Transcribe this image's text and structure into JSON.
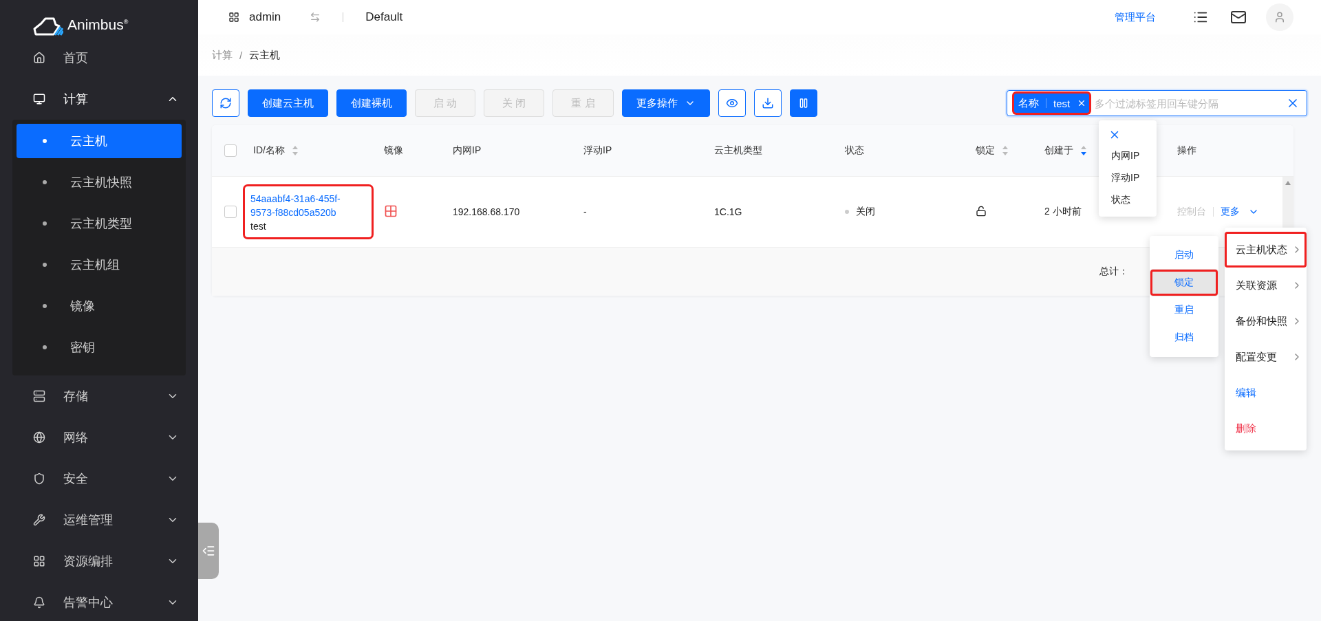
{
  "brand": {
    "name": "Animbus",
    "mark": "®"
  },
  "sidebar": {
    "items": [
      {
        "label": "首页",
        "kind": "link",
        "expanded": false
      },
      {
        "label": "计算",
        "kind": "group",
        "expanded": true,
        "children": [
          {
            "label": "云主机",
            "selected": true
          },
          {
            "label": "云主机快照",
            "selected": false
          },
          {
            "label": "云主机类型",
            "selected": false
          },
          {
            "label": "云主机组",
            "selected": false
          },
          {
            "label": "镜像",
            "selected": false
          },
          {
            "label": "密钥",
            "selected": false
          }
        ]
      },
      {
        "label": "存储",
        "kind": "group",
        "expanded": false
      },
      {
        "label": "网络",
        "kind": "group",
        "expanded": false
      },
      {
        "label": "安全",
        "kind": "group",
        "expanded": false
      },
      {
        "label": "运维管理",
        "kind": "group",
        "expanded": false
      },
      {
        "label": "资源编排",
        "kind": "group",
        "expanded": false
      },
      {
        "label": "告警中心",
        "kind": "group",
        "expanded": false
      }
    ]
  },
  "header": {
    "project": "admin",
    "region": "Default",
    "admin_link": "管理平台"
  },
  "breadcrumb": {
    "items": [
      "计算",
      "云主机"
    ],
    "separator": "/"
  },
  "toolbar": {
    "buttons": [
      {
        "label": "创建云主机",
        "disabled": false
      },
      {
        "label": "创建裸机",
        "disabled": false
      },
      {
        "label": "启 动",
        "disabled": true
      },
      {
        "label": "关 闭",
        "disabled": true
      },
      {
        "label": "重 启",
        "disabled": true
      }
    ],
    "more_button": "更多操作"
  },
  "search": {
    "tag": {
      "key": "名称",
      "value": "test",
      "annotated": true
    },
    "placeholder": "多个过滤标签用回车键分隔",
    "options": [
      "内网IP",
      "浮动IP",
      "状态"
    ]
  },
  "table": {
    "all_checked": false,
    "columns": [
      {
        "label": "ID/名称",
        "sort_desc": false
      },
      {
        "label": "镜像"
      },
      {
        "label": "内网IP"
      },
      {
        "label": "浮动IP"
      },
      {
        "label": "云主机类型"
      },
      {
        "label": "状态"
      },
      {
        "label": "锁定",
        "sort_desc": false
      },
      {
        "label": "创建于",
        "sort_desc": true
      },
      {
        "label": "操作"
      }
    ],
    "rows": [
      {
        "checked": false,
        "id": "54aaabf4-31a6-455f-9573-f88cd05a520b",
        "name": "test",
        "annotated": true,
        "fixed_ip": "192.168.68.170",
        "floating_ip": "-",
        "flavor": "1C.1G",
        "status": "关闭",
        "color": "#cccccc",
        "locked": false,
        "created": "2 小时前",
        "console": {
          "label": "控制台",
          "disabled": true
        },
        "more": "更多"
      }
    ],
    "total": "总计："
  },
  "more_menu": {
    "items": [
      {
        "label": "云主机状态",
        "kind": "submenu",
        "annotated": true
      },
      {
        "label": "关联资源",
        "kind": "submenu",
        "annotated": false
      },
      {
        "label": "备份和快照",
        "kind": "submenu",
        "annotated": false
      },
      {
        "label": "配置变更",
        "kind": "submenu",
        "annotated": false
      },
      {
        "label": "编辑",
        "kind": "action",
        "annotated": false
      },
      {
        "label": "删除",
        "kind": "danger",
        "annotated": false
      }
    ],
    "submenu": [
      {
        "label": "启动",
        "selected": false,
        "annotated": false
      },
      {
        "label": "锁定",
        "selected": true,
        "annotated": true
      },
      {
        "label": "重启",
        "selected": false,
        "annotated": false
      },
      {
        "label": "归档",
        "selected": false,
        "annotated": false
      }
    ]
  }
}
